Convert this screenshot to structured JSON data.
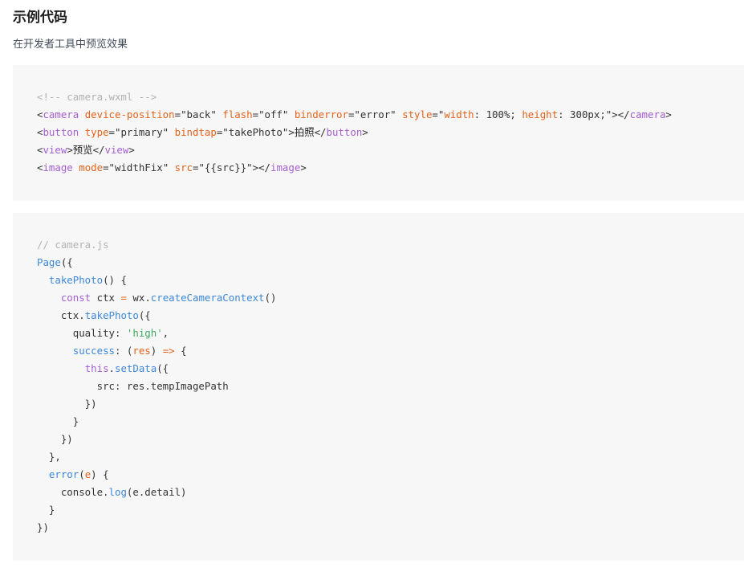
{
  "header": {
    "title": "示例代码",
    "subtitle": "在开发者工具中预览效果"
  },
  "wxml": {
    "comment": "<!-- camera.wxml -->",
    "line1": {
      "open": "<",
      "tag": "camera",
      "attr1": "device-position",
      "val1": "=\"back\" ",
      "attr2": "flash",
      "val2": "=\"off\" ",
      "attr3": "binderror",
      "val3": "=\"error\" ",
      "attr4": "style",
      "val4a": "=\"",
      "attr5": "width",
      "val5": ": 100%; ",
      "attr6": "height",
      "val6": ": 300px;\">",
      "close_open": "</",
      "close_tag": "camera",
      "close_end": ">"
    },
    "line2": {
      "open": "<",
      "tag": "button",
      "attr1": "type",
      "val1": "=\"primary\" ",
      "attr2": "bindtap",
      "val2": "=\"takePhoto\">",
      "text": "拍照",
      "close_open": "</",
      "close_tag": "button",
      "close_end": ">"
    },
    "line3": {
      "open": "<",
      "tag": "view",
      "mid": ">",
      "text": "预览",
      "close_open": "</",
      "close_tag": "view",
      "close_end": ">"
    },
    "line4": {
      "open": "<",
      "tag": "image",
      "attr1": "mode",
      "val1": "=\"widthFix\" ",
      "attr2": "src",
      "val2": "=\"{{src}}\">",
      "close_open": "</",
      "close_tag": "image",
      "close_end": ">"
    }
  },
  "js": {
    "comment": "// camera.js",
    "l1_func": "Page",
    "l1_rest": "({",
    "l2_indent": "  ",
    "l2_func": "takePhoto",
    "l2_rest": "() {",
    "l3_indent": "    ",
    "l3_kw": "const",
    "l3_a": " ctx ",
    "l3_op": "=",
    "l3_b": " wx.",
    "l3_func": "createCameraContext",
    "l3_rest": "()",
    "l4_indent": "    ",
    "l4_a": "ctx.",
    "l4_func": "takePhoto",
    "l4_rest": "({",
    "l5_indent": "      ",
    "l5_a": "quality: ",
    "l5_str": "'high'",
    "l5_rest": ",",
    "l6_indent": "      ",
    "l6_func": "success",
    "l6_a": ": (",
    "l6_param": "res",
    "l6_b": ") ",
    "l6_op": "=>",
    "l6_rest": " {",
    "l7_indent": "        ",
    "l7_kw": "this",
    "l7_a": ".",
    "l7_func": "setData",
    "l7_rest": "({",
    "l8_indent": "          ",
    "l8_a": "src: res.tempImagePath",
    "l9": "        })",
    "l10": "      }",
    "l11": "    })",
    "l12": "  },",
    "l13_indent": "  ",
    "l13_func": "error",
    "l13_a": "(",
    "l13_param": "e",
    "l13_rest": ") {",
    "l14_indent": "    ",
    "l14_a": "console.",
    "l14_func": "log",
    "l14_rest": "(e.detail)",
    "l15": "  }",
    "l16": "})"
  }
}
